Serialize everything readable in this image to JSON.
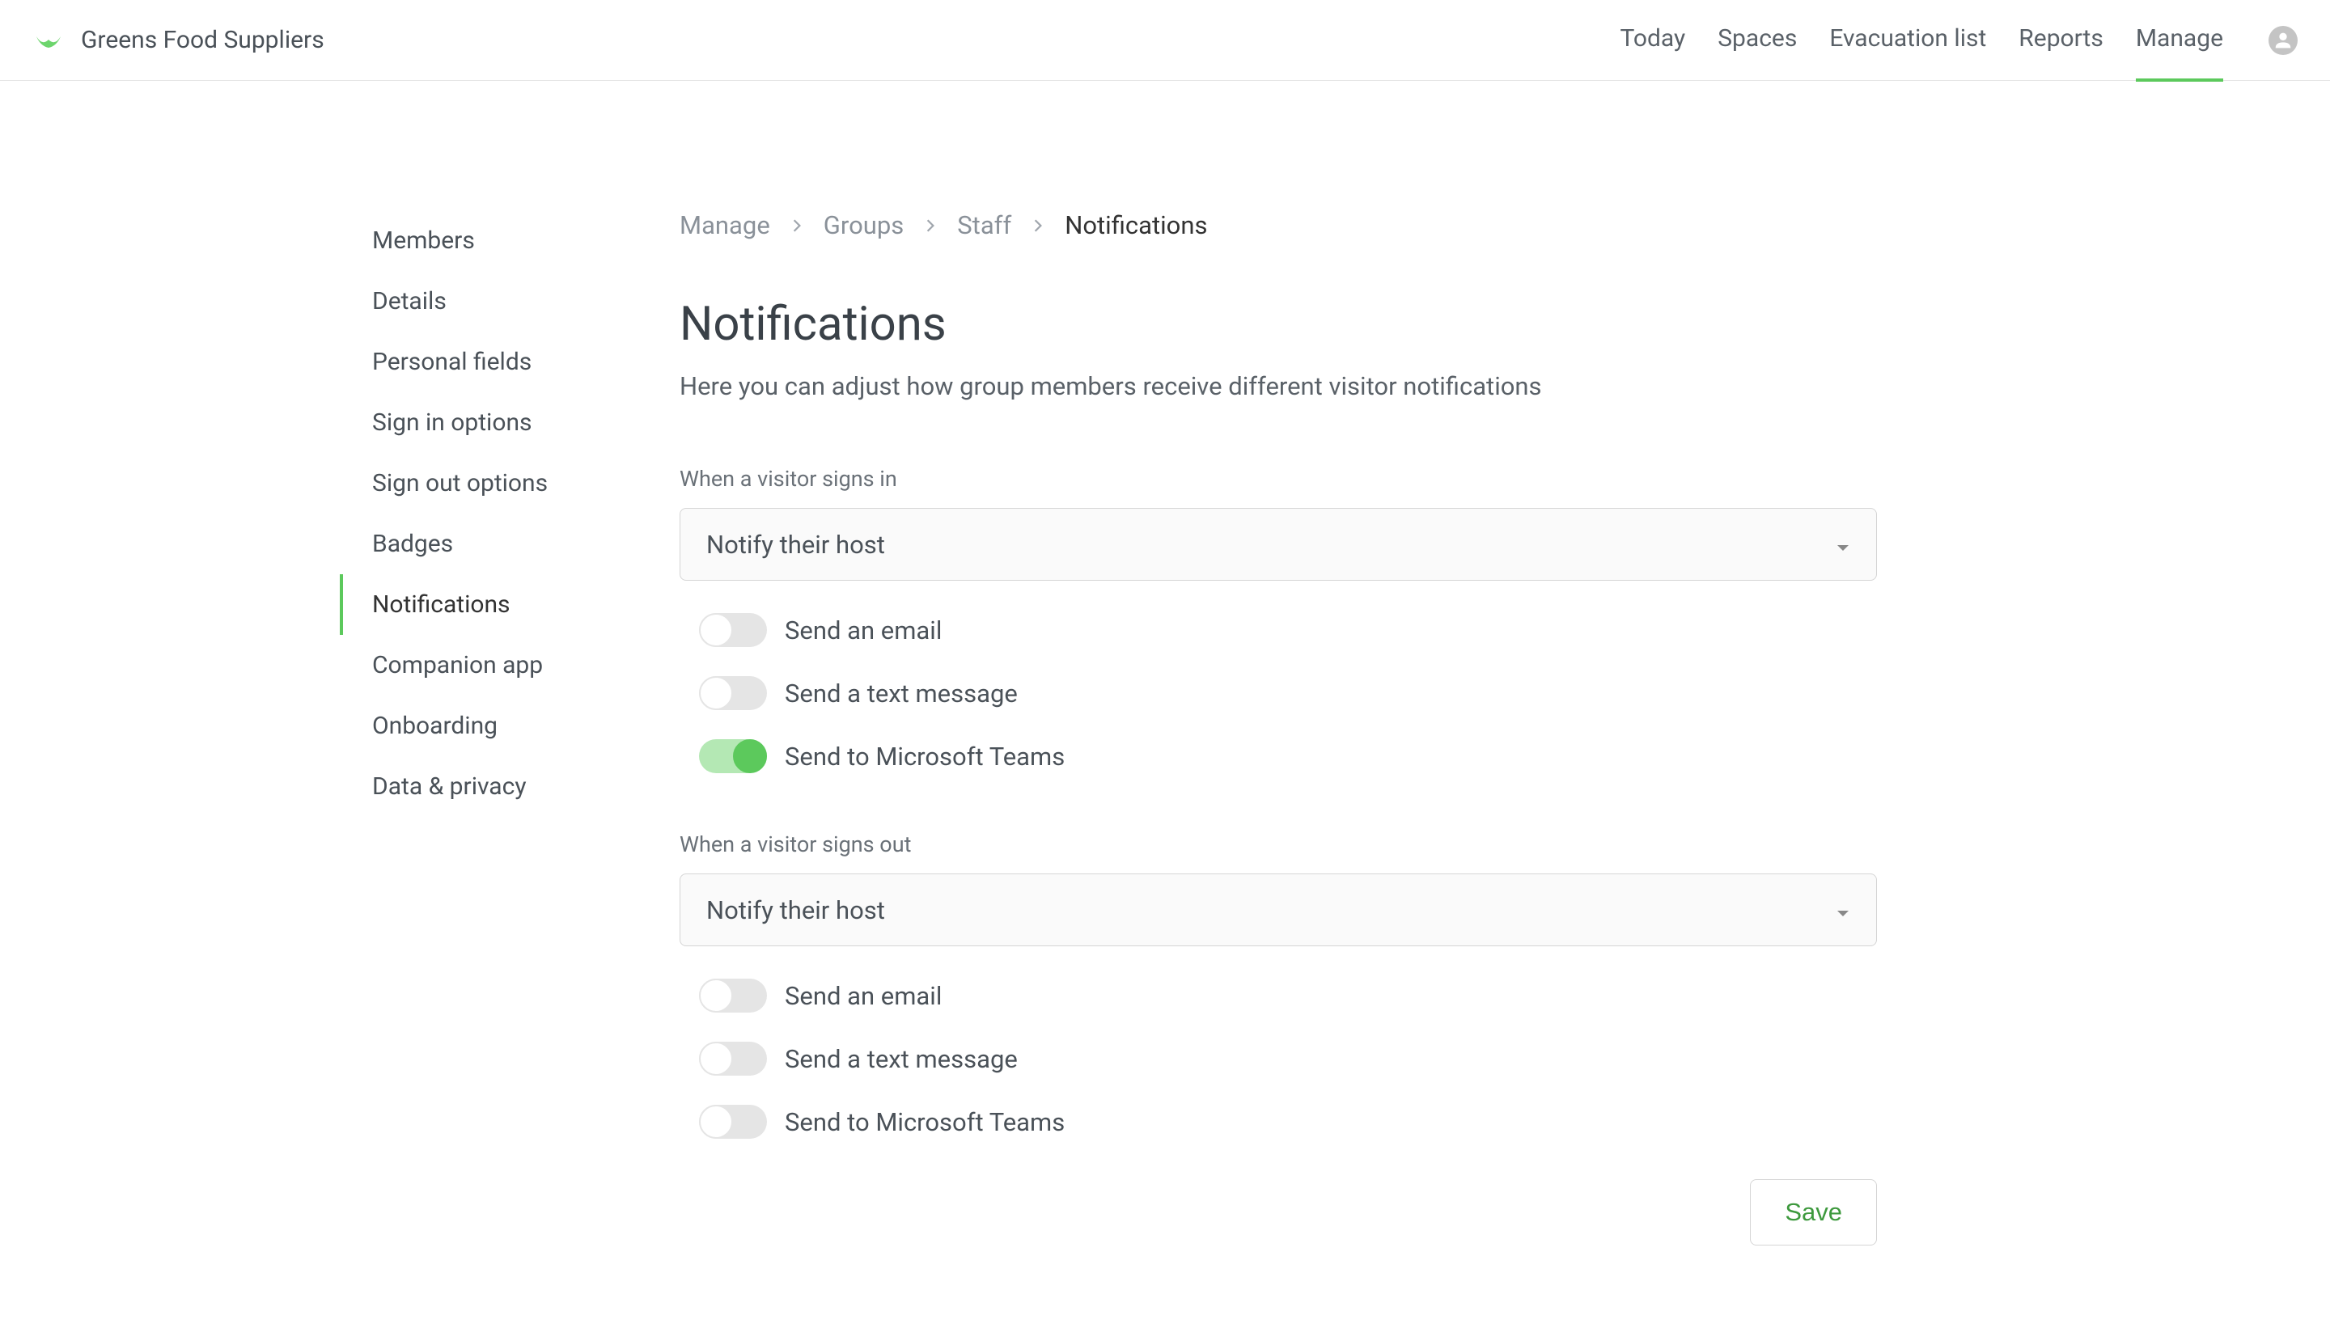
{
  "header": {
    "company_name": "Greens Food Suppliers",
    "nav": {
      "today": "Today",
      "spaces": "Spaces",
      "evacuation": "Evacuation list",
      "reports": "Reports",
      "manage": "Manage"
    }
  },
  "breadcrumb": {
    "manage": "Manage",
    "groups": "Groups",
    "staff": "Staff",
    "notifications": "Notifications"
  },
  "sidebar": {
    "members": "Members",
    "details": "Details",
    "personal_fields": "Personal fields",
    "sign_in_options": "Sign in options",
    "sign_out_options": "Sign out options",
    "badges": "Badges",
    "notifications": "Notifications",
    "companion_app": "Companion app",
    "onboarding": "Onboarding",
    "data_privacy": "Data & privacy"
  },
  "page": {
    "title": "Notifications",
    "subtitle": "Here you can adjust how group members receive different visitor notifications"
  },
  "sections": {
    "sign_in": {
      "label": "When a visitor signs in",
      "select_value": "Notify their host",
      "toggles": {
        "email": "Send an email",
        "text": "Send a text message",
        "teams": "Send to Microsoft Teams"
      }
    },
    "sign_out": {
      "label": "When a visitor signs out",
      "select_value": "Notify their host",
      "toggles": {
        "email": "Send an email",
        "text": "Send a text message",
        "teams": "Send to Microsoft Teams"
      }
    }
  },
  "buttons": {
    "save": "Save"
  }
}
